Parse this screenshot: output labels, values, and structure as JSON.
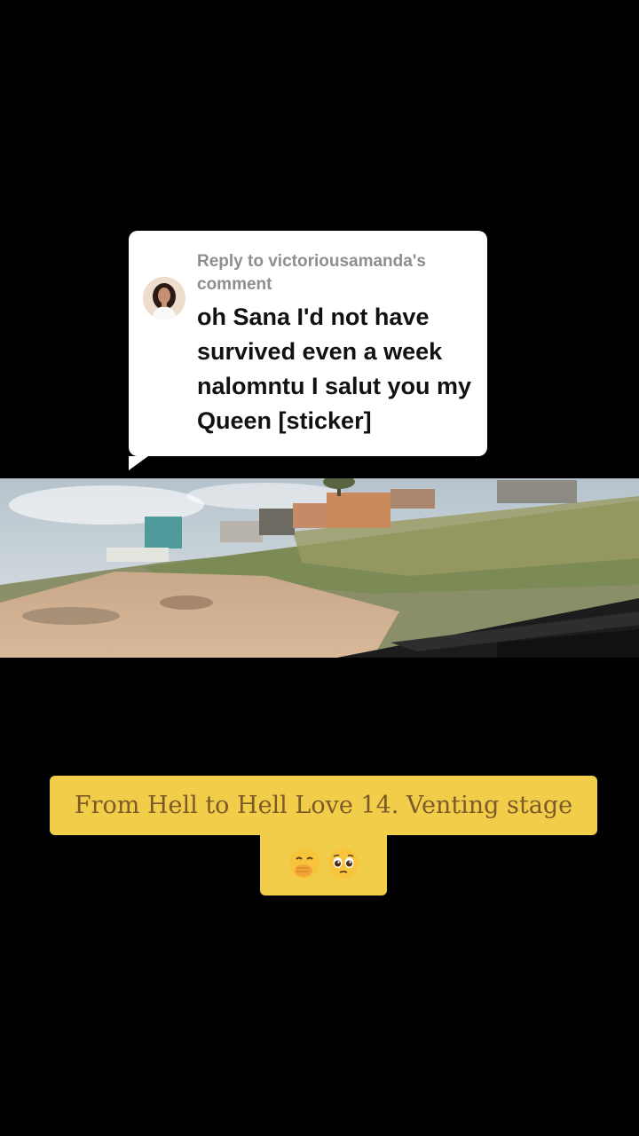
{
  "reply": {
    "header": "Reply to victoriousamanda's comment",
    "comment": "oh Sana I'd not have survived even a week nalomntu I salut you my Queen [sticker]"
  },
  "caption": {
    "line1": "From Hell to Hell Love 14. Venting stage",
    "emojis": [
      "face-with-hand-over-mouth-emoji",
      "pleading-face-emoji"
    ]
  },
  "colors": {
    "background": "#000000",
    "bubble": "#ffffff",
    "caption_bg": "#f2cd4a",
    "caption_text": "#7b5a2a",
    "reply_header": "#8e8e8e"
  }
}
